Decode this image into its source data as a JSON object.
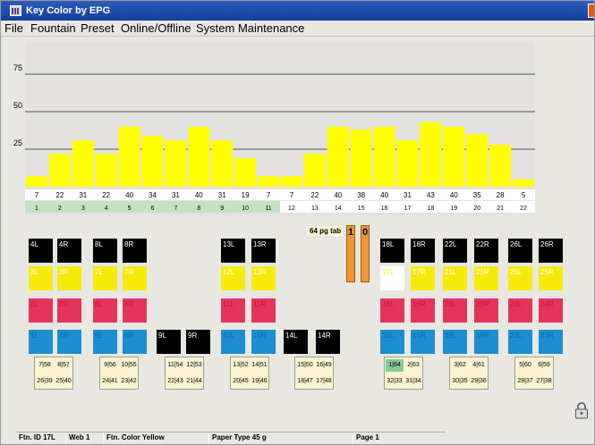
{
  "window": {
    "title": "Key Color by EPG"
  },
  "menu": [
    "File",
    "Fountain",
    "Preset",
    "Online/Offline",
    "System Maintenance"
  ],
  "chart_data": {
    "type": "bar",
    "categories": [
      "1",
      "2",
      "3",
      "4",
      "5",
      "6",
      "7",
      "8",
      "9",
      "10",
      "11",
      "12",
      "13",
      "14",
      "15",
      "16",
      "17",
      "18",
      "19",
      "20",
      "21",
      "22"
    ],
    "values": [
      7,
      22,
      31,
      22,
      40,
      34,
      31,
      40,
      31,
      19,
      7,
      7,
      22,
      40,
      38,
      40,
      31,
      43,
      40,
      35,
      28,
      5
    ],
    "yticks": [
      25,
      50,
      75
    ],
    "ylim": [
      0,
      93
    ],
    "grid": true,
    "bar_color": "#ffff00",
    "zone_highlight_color": "#c7e1c4"
  },
  "keys": {
    "black_top": [
      "4L",
      "4R",
      "8L",
      "8R",
      "13L",
      "13R",
      "18L",
      "18R",
      "22L",
      "22R",
      "26L",
      "26R"
    ],
    "yellow": [
      "3L",
      "3R",
      "7L",
      "7R",
      "12L",
      "12R",
      "17L",
      "17R",
      "21L",
      "21R",
      "25L",
      "25R"
    ],
    "magenta": [
      "2L",
      "2R",
      "6L",
      "6R",
      "11L",
      "11R",
      "16L",
      "16R",
      "20L",
      "20R",
      "24L",
      "24R"
    ],
    "cyan": [
      "1L",
      "1R",
      "5L",
      "5R",
      "10L",
      "10R",
      "15L",
      "15R",
      "19L",
      "19R",
      "23L",
      "23R"
    ],
    "black_extra": [
      "9L",
      "9R",
      "14L",
      "14R"
    ]
  },
  "page_tab": {
    "label": "64 pg tab",
    "tabs": [
      "1",
      "0"
    ]
  },
  "page_grids": [
    {
      "top": [
        "7|58",
        "8|57"
      ],
      "bottom": [
        "26|39",
        "25|40"
      ]
    },
    {
      "top": [
        "9|56",
        "10|55"
      ],
      "bottom": [
        "24|41",
        "23|42"
      ]
    },
    {
      "top": [
        "11|54",
        "12|53"
      ],
      "bottom": [
        "22|43",
        "21|44"
      ]
    },
    {
      "top": [
        "13|52",
        "14|51"
      ],
      "bottom": [
        "20|45",
        "19|46"
      ]
    },
    {
      "top": [
        "15|50",
        "16|49"
      ],
      "bottom": [
        "18|47",
        "17|48"
      ]
    },
    {
      "top": [
        "1|64",
        "2|63"
      ],
      "bottom": [
        "32|33",
        "31|34"
      ]
    },
    {
      "top": [
        "3|62",
        "4|61"
      ],
      "bottom": [
        "30|35",
        "29|36"
      ]
    },
    {
      "top": [
        "5|60",
        "6|59"
      ],
      "bottom": [
        "28|37",
        "27|38"
      ]
    }
  ],
  "status": {
    "ftn_id": "Ftn. ID  17L",
    "web": "Web  1",
    "ftn_color": "Ftn. Color  Yellow",
    "paper_type": "Paper Type  45 g",
    "page": "Page 1"
  },
  "colors": {
    "black": "#000000",
    "yellow": "#f5ea0a",
    "magenta": "#e5345b",
    "cyan": "#1c8ed2",
    "accent": "#2d5dbd",
    "page_tab": "#f09535"
  },
  "icons": [
    "app-icon",
    "close-icon",
    "lock-icon"
  ]
}
